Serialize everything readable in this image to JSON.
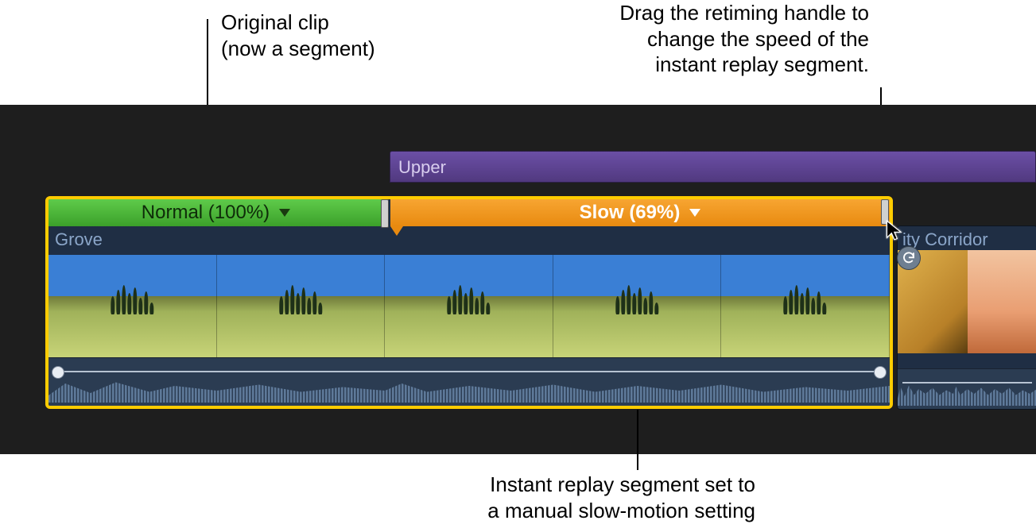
{
  "annotations": {
    "top_left_l1": "Original clip",
    "top_left_l2": "(now a segment)",
    "top_right_l1": "Drag the retiming handle to",
    "top_right_l2": "change the speed of the",
    "top_right_l3": "instant replay segment.",
    "bottom_l1": "Instant replay segment set to",
    "bottom_l2": "a manual slow-motion setting"
  },
  "tracks": {
    "upper_label": "Upper"
  },
  "segments": {
    "normal_label": "Normal (100%)",
    "slow_label": "Slow (69%)"
  },
  "clips": {
    "selected_name": "Grove",
    "right_name": "ity Corridor"
  }
}
